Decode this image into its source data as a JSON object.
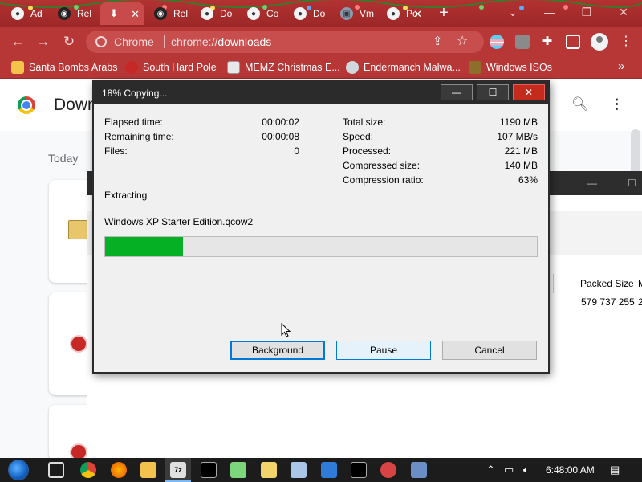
{
  "tabs": [
    {
      "label": "Ad",
      "icon": "globe-icon"
    },
    {
      "label": "Rel",
      "icon": "github-icon"
    },
    {
      "label": "",
      "icon": "download-icon",
      "active": true
    },
    {
      "label": "Rel",
      "icon": "github-icon"
    },
    {
      "label": "Do",
      "icon": "globe-icon"
    },
    {
      "label": "Co",
      "icon": "globe-icon"
    },
    {
      "label": "Do",
      "icon": "globe-icon"
    },
    {
      "label": "Vm",
      "icon": "vmware-icon"
    },
    {
      "label": "Po",
      "icon": "globe-icon"
    }
  ],
  "address_bar": {
    "site_label": "Chrome",
    "url_prefix": "chrome://",
    "url_page": "downloads"
  },
  "bookmarks": [
    {
      "label": "Santa Bombs Arabs",
      "icon": "app-icon",
      "color": "#f3c34a"
    },
    {
      "label": "South Hard Pole",
      "icon": "gift-icon",
      "color": "#c62828"
    },
    {
      "label": "MEMZ Christmas E...",
      "icon": "image-icon",
      "color": "#e8e8e8"
    },
    {
      "label": "Endermanch Malwa...",
      "icon": "avatar-icon",
      "color": "#cfd8dc"
    },
    {
      "label": "Windows ISOs",
      "icon": "tree-icon",
      "color": "#8d6e2a"
    }
  ],
  "downloads_page": {
    "title": "Downloads",
    "section": "Today"
  },
  "background_window": {
    "packed_size_header": "Packed Size",
    "next_header": "M",
    "packed_size_value": "579 737 255",
    "next_value": "2"
  },
  "dialog": {
    "title": "18% Copying...",
    "left_stats": [
      {
        "label": "Elapsed time:",
        "value": "00:00:02"
      },
      {
        "label": "Remaining time:",
        "value": "00:00:08"
      },
      {
        "label": "Files:",
        "value": "0"
      }
    ],
    "right_stats": [
      {
        "label": "Total size:",
        "value": "1190 MB"
      },
      {
        "label": "Speed:",
        "value": "107 MB/s"
      },
      {
        "label": "Processed:",
        "value": "221 MB"
      },
      {
        "label": "Compressed size:",
        "value": "140 MB"
      },
      {
        "label": "Compression ratio:",
        "value": "63%"
      }
    ],
    "operation": "Extracting",
    "filename": "Windows XP Starter Edition.qcow2",
    "progress_fraction": 0.18,
    "buttons": {
      "background": "Background",
      "pause": "Pause",
      "cancel": "Cancel"
    },
    "title_buttons": {
      "minimize": "—",
      "maximize": "☐",
      "close": "✕"
    }
  },
  "taskbar": {
    "clock": "6:48:00 AM"
  },
  "colors": {
    "theme_red": "#b73737",
    "progress_green": "#06b025",
    "focus_blue": "#0078d7"
  }
}
